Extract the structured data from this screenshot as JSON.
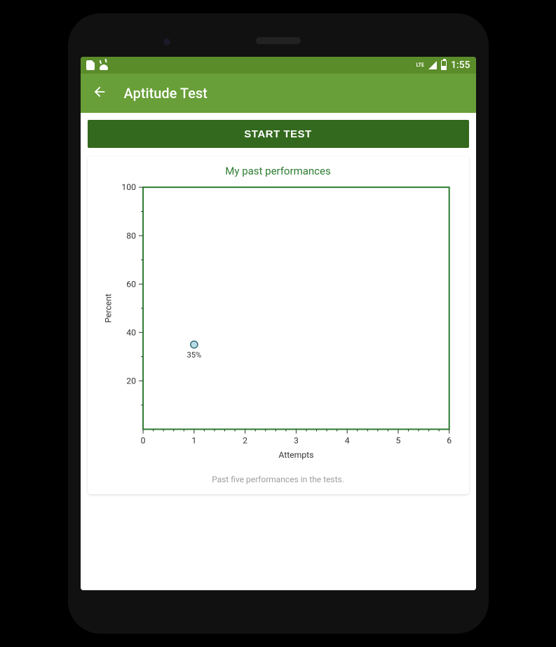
{
  "status_bar": {
    "network_label": "LTE",
    "time": "1:55"
  },
  "app_bar": {
    "title": "Aptitude Test"
  },
  "actions": {
    "start_label": "START TEST"
  },
  "chart": {
    "title": "My past performances",
    "footnote": "Past five performances in the tests."
  },
  "chart_data": {
    "type": "scatter",
    "title": "My past performances",
    "xlabel": "Attempts",
    "ylabel": "Percent",
    "xlim": [
      0,
      6
    ],
    "ylim": [
      0,
      100
    ],
    "x_ticks": [
      0,
      1,
      2,
      3,
      4,
      5,
      6
    ],
    "y_ticks": [
      20,
      40,
      60,
      80,
      100
    ],
    "series": [
      {
        "name": "Percent",
        "points": [
          {
            "x": 1,
            "y": 35,
            "label": "35%"
          }
        ]
      }
    ]
  },
  "colors": {
    "status_bar": "#5b8c2a",
    "app_bar": "#689f38",
    "button": "#33691e",
    "chart_border": "#2e7d32",
    "chart_title": "#2e7d32",
    "point_fill": "#b7dce5",
    "point_stroke": "#3b6f7a"
  }
}
